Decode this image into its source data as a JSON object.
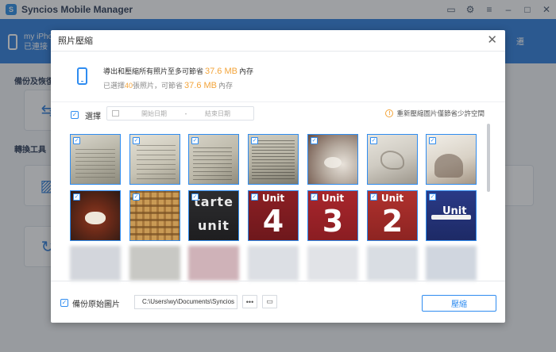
{
  "app": {
    "title": "Syncios Mobile Manager",
    "device_name": "my iPhon",
    "device_status": "已連接",
    "sections": [
      "備份及恢復",
      "轉換工具"
    ],
    "nav_right_label": "遷"
  },
  "window_controls": [
    "monitor-icon",
    "gear-icon",
    "menu-icon",
    "minimize-icon",
    "maximize-icon",
    "close-icon"
  ],
  "dialog": {
    "title": "照片壓縮",
    "close": "✕",
    "info": {
      "line1_prefix": "導出和壓縮所有照片至多可節省",
      "line1_size": "37.6 MB",
      "line1_suffix": "內存",
      "line2_prefix": "已選擇",
      "line2_count": "40",
      "line2_mid": "張照片，可節省",
      "line2_size": "37.6 MB",
      "line2_suffix": "內存"
    },
    "filter": {
      "select_label": "選擇",
      "start_placeholder": "開始日期",
      "separator": "-",
      "end_placeholder": "結束日期",
      "warning": "重新壓縮圖片僅節省少許空間"
    },
    "photos": [
      {
        "name": "photo-doc-1",
        "style": "doc",
        "checked": true
      },
      {
        "name": "photo-doc-2",
        "style": "doc",
        "checked": true
      },
      {
        "name": "photo-doc-3",
        "style": "doc",
        "checked": true
      },
      {
        "name": "photo-doc-4",
        "style": "doc",
        "checked": true
      },
      {
        "name": "photo-art-1",
        "style": "art1",
        "checked": true
      },
      {
        "name": "photo-art-2",
        "style": "art2",
        "checked": true
      },
      {
        "name": "photo-art-3",
        "style": "art3",
        "checked": true
      },
      {
        "name": "photo-food",
        "style": "food",
        "checked": true
      },
      {
        "name": "photo-waffle",
        "style": "waffle",
        "checked": true
      },
      {
        "name": "photo-tarte-unit",
        "style": "dark",
        "text": "tarte unit",
        "checked": true
      },
      {
        "name": "photo-unit-4",
        "style": "red4",
        "text": "4",
        "checked": true
      },
      {
        "name": "photo-unit-3",
        "style": "red3",
        "text": "3",
        "checked": true
      },
      {
        "name": "photo-unit-2",
        "style": "red2",
        "text": "2",
        "checked": true
      },
      {
        "name": "photo-unit-1",
        "style": "blue1",
        "text": "Unit",
        "checked": true
      }
    ],
    "footer": {
      "backup_label": "備份原始圖片",
      "path": "C:\\Users\\wy\\Documents\\Syncios",
      "more_button": "•••",
      "compress_button": "壓縮"
    }
  },
  "colors": {
    "accent": "#2f8cf0",
    "orange": "#f3a43a",
    "nav_blue": "#2f7fdc"
  }
}
